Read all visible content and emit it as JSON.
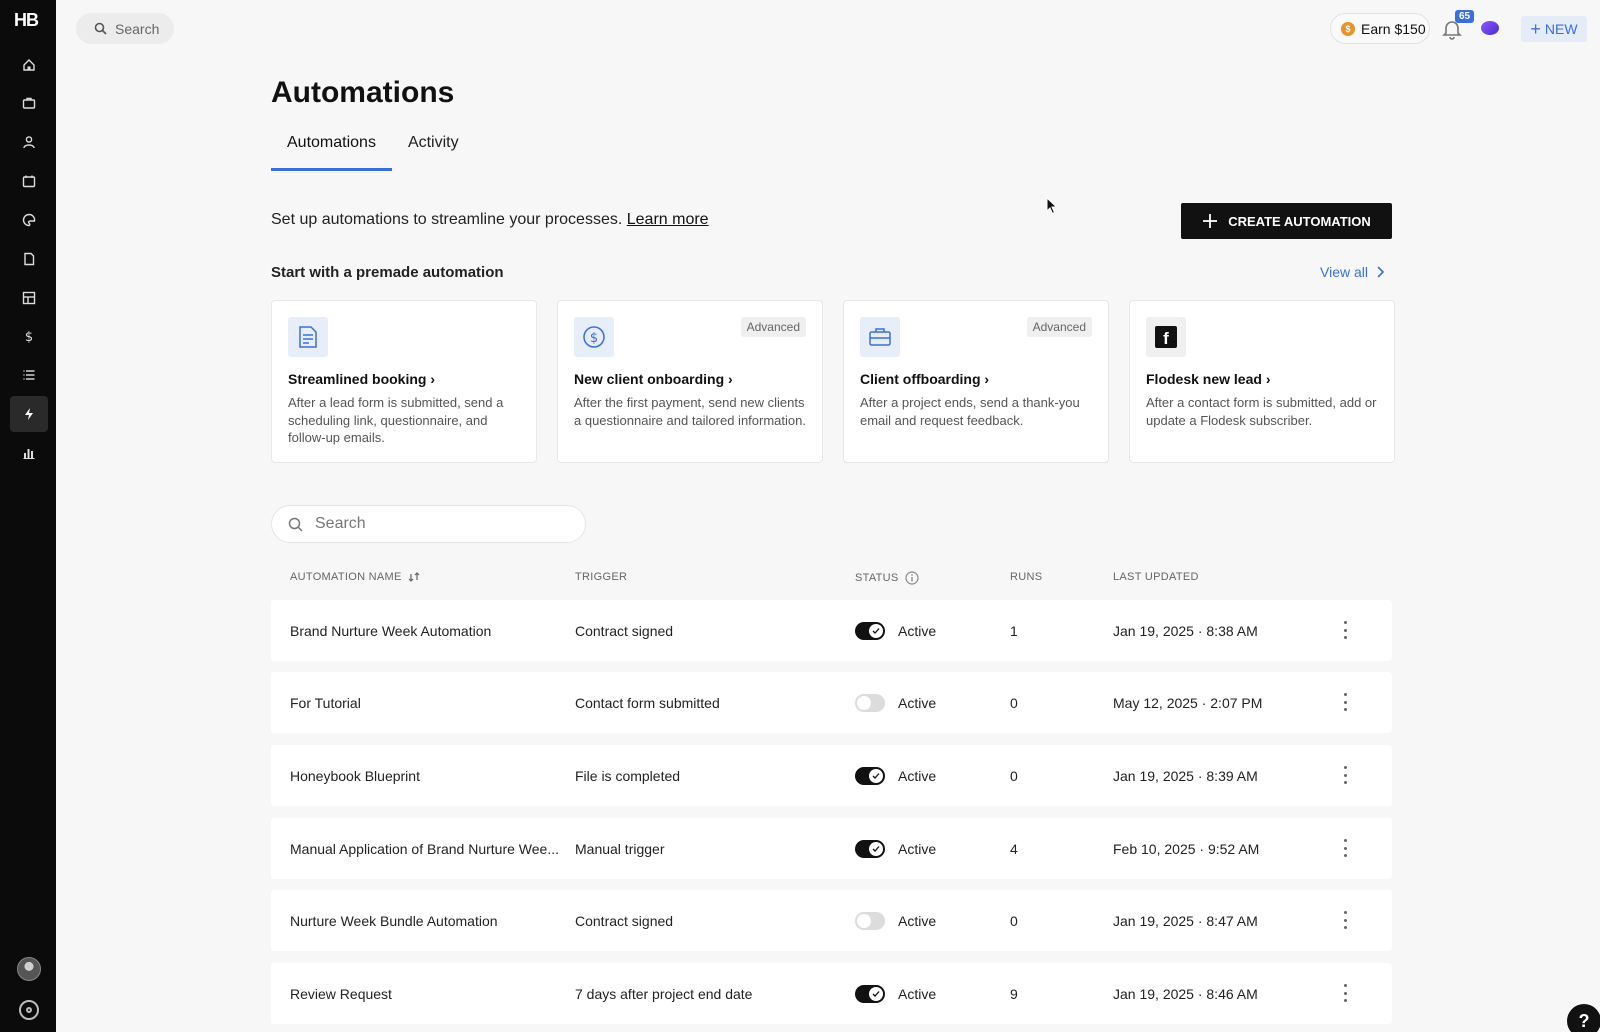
{
  "brand": {
    "logo_text": "HB"
  },
  "sidebar": {
    "items": [
      {
        "icon": "home-icon"
      },
      {
        "icon": "briefcase-icon"
      },
      {
        "icon": "user-icon"
      },
      {
        "icon": "calendar-icon"
      },
      {
        "icon": "palette-icon"
      },
      {
        "icon": "document-icon"
      },
      {
        "icon": "template-icon"
      },
      {
        "icon": "dollar-icon"
      },
      {
        "icon": "list-icon"
      },
      {
        "icon": "lightning-icon"
      },
      {
        "icon": "bar-chart-icon"
      }
    ],
    "active_index": 9
  },
  "topbar": {
    "search_label": "Search",
    "earn_label": "Earn $150",
    "notifications_count": "65",
    "new_label": "NEW"
  },
  "page": {
    "title": "Automations",
    "tabs": [
      "Automations",
      "Activity"
    ],
    "active_tab": 0,
    "intro_text": "Set up automations to streamline your processes.",
    "learn_more": "Learn more",
    "create_label": "CREATE AUTOMATION"
  },
  "premade": {
    "title": "Start with a premade automation",
    "view_all": "View all",
    "cards": [
      {
        "icon": "form-icon",
        "title": "Streamlined booking",
        "badge": "",
        "desc": "After a lead form is submitted, send a scheduling link, questionnaire, and follow-up emails."
      },
      {
        "icon": "dollar-circle-icon",
        "title": "New client onboarding",
        "badge": "Advanced",
        "desc": "After the first payment, send new clients a questionnaire and tailored information."
      },
      {
        "icon": "briefcase-icon",
        "title": "Client offboarding",
        "badge": "Advanced",
        "desc": "After a project ends, send a thank-you email and request feedback."
      },
      {
        "icon": "flodesk-icon",
        "title": "Flodesk new lead",
        "badge": "",
        "desc": "After a contact form is submitted, add or update a Flodesk subscriber."
      }
    ]
  },
  "list": {
    "search_placeholder": "Search",
    "headers": {
      "name": "AUTOMATION NAME",
      "trigger": "TRIGGER",
      "status": "STATUS",
      "runs": "RUNS",
      "updated": "LAST UPDATED"
    },
    "rows": [
      {
        "name": "Brand Nurture Week Automation",
        "trigger": "Contract signed",
        "on": true,
        "status": "Active",
        "runs": "1",
        "updated": "Jan 19, 2025 · 8:38 AM"
      },
      {
        "name": "For Tutorial",
        "trigger": "Contact form submitted",
        "on": false,
        "status": "Active",
        "runs": "0",
        "updated": "May 12, 2025 · 2:07 PM"
      },
      {
        "name": "Honeybook Blueprint",
        "trigger": "File is completed",
        "on": true,
        "status": "Active",
        "runs": "0",
        "updated": "Jan 19, 2025 · 8:39 AM"
      },
      {
        "name": "Manual Application of Brand Nurture Wee...",
        "trigger": "Manual trigger",
        "on": true,
        "status": "Active",
        "runs": "4",
        "updated": "Feb 10, 2025 · 9:52 AM"
      },
      {
        "name": "Nurture Week Bundle Automation",
        "trigger": "Contract signed",
        "on": false,
        "status": "Active",
        "runs": "0",
        "updated": "Jan 19, 2025 · 8:47 AM"
      },
      {
        "name": "Review Request",
        "trigger": "7 days after project end date",
        "on": true,
        "status": "Active",
        "runs": "9",
        "updated": "Jan 19, 2025 · 8:46 AM"
      }
    ]
  },
  "help_label": "?",
  "colors": {
    "accent": "#3b6fd9",
    "sidebar": "#0b0b0b",
    "primary_button": "#111111"
  }
}
